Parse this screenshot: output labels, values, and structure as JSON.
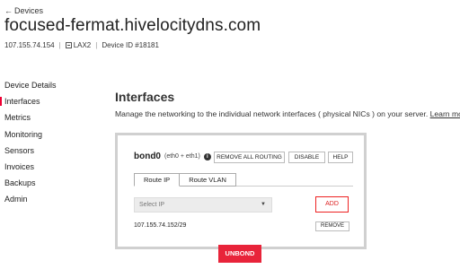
{
  "breadcrumb": {
    "arrow": "←",
    "label": "Devices"
  },
  "page": {
    "title": "focused-fermat.hivelocitydns.com"
  },
  "meta": {
    "ip": "107.155.74.154",
    "separator": "|",
    "location": "LAX2",
    "device_id": "Device ID #18181"
  },
  "sidebar": {
    "items": [
      {
        "label": "Device Details",
        "active": false
      },
      {
        "label": "Interfaces",
        "active": true
      },
      {
        "label": "Metrics",
        "active": false
      },
      {
        "label": "Monitoring",
        "active": false
      },
      {
        "label": "Sensors",
        "active": false
      },
      {
        "label": "Invoices",
        "active": false
      },
      {
        "label": "Backups",
        "active": false
      },
      {
        "label": "Admin",
        "active": false
      }
    ]
  },
  "interfaces": {
    "title": "Interfaces",
    "description": "Manage the networking to the individual network interfaces ( physical NICs ) on your server.",
    "learn_more": "Learn more."
  },
  "bond": {
    "name": "bond0",
    "members": "(eth0 + eth1)",
    "info_icon": "i",
    "buttons": {
      "remove_all": "REMOVE ALL ROUTING",
      "disable": "DISABLE",
      "help": "HELP"
    },
    "tabs": [
      {
        "label": "Route IP",
        "active": true
      },
      {
        "label": "Route VLAN",
        "active": false
      }
    ],
    "select": {
      "placeholder": "Select IP",
      "caret": "▼"
    },
    "add_label": "ADD",
    "routes": [
      {
        "ip": "107.155.74.152/29",
        "remove_label": "REMOVE"
      }
    ],
    "unbond_label": "UNBOND"
  },
  "colors": {
    "accent": "#e8243a",
    "border": "#d0d0d0"
  }
}
